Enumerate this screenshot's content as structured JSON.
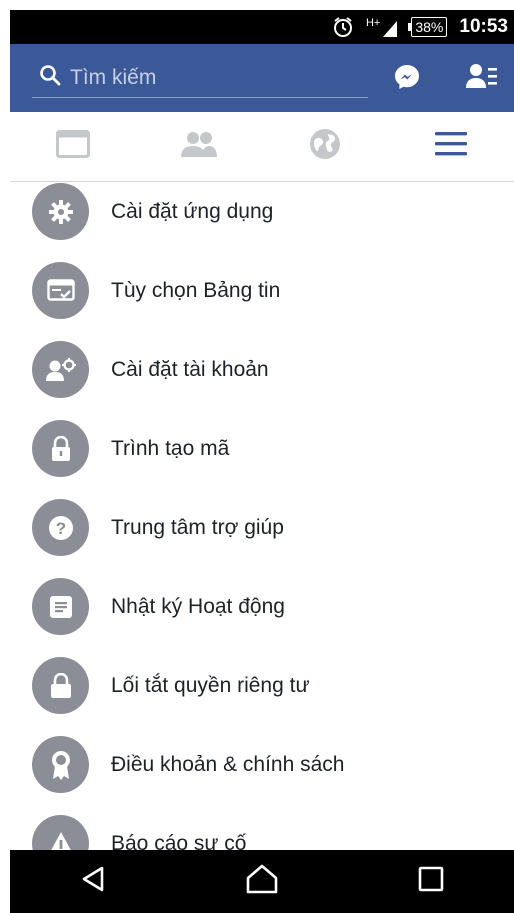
{
  "status_bar": {
    "alarm_icon": "alarm-icon",
    "network_label": "H+",
    "battery_percent": "38%",
    "time": "10:53"
  },
  "top_bar": {
    "search_placeholder": "Tìm kiếm",
    "brand_color": "#3b5998"
  },
  "tabs": [
    {
      "icon": "news-feed-icon",
      "active": false
    },
    {
      "icon": "friends-icon",
      "active": false
    },
    {
      "icon": "globe-icon",
      "active": false
    },
    {
      "icon": "menu-icon",
      "active": true
    }
  ],
  "menu": {
    "items": [
      {
        "label": "Cài đặt ứng dụng",
        "icon": "gear-icon"
      },
      {
        "label": "Tùy chọn Bảng tin",
        "icon": "feed-preferences-icon"
      },
      {
        "label": "Cài đặt tài khoản",
        "icon": "account-settings-icon"
      },
      {
        "label": "Trình tạo mã",
        "icon": "lock-icon"
      },
      {
        "label": "Trung tâm trợ giúp",
        "icon": "help-icon"
      },
      {
        "label": "Nhật ký Hoạt động",
        "icon": "activity-log-icon"
      },
      {
        "label": "Lối tắt quyền riêng tư",
        "icon": "privacy-lock-icon"
      },
      {
        "label": "Điều khoản & chính sách",
        "icon": "badge-icon"
      },
      {
        "label": "Báo cáo sự cố",
        "icon": "warning-icon"
      }
    ]
  },
  "nav_bar": {
    "back_icon": "back-icon",
    "home_icon": "home-icon",
    "recents_icon": "recents-icon"
  }
}
